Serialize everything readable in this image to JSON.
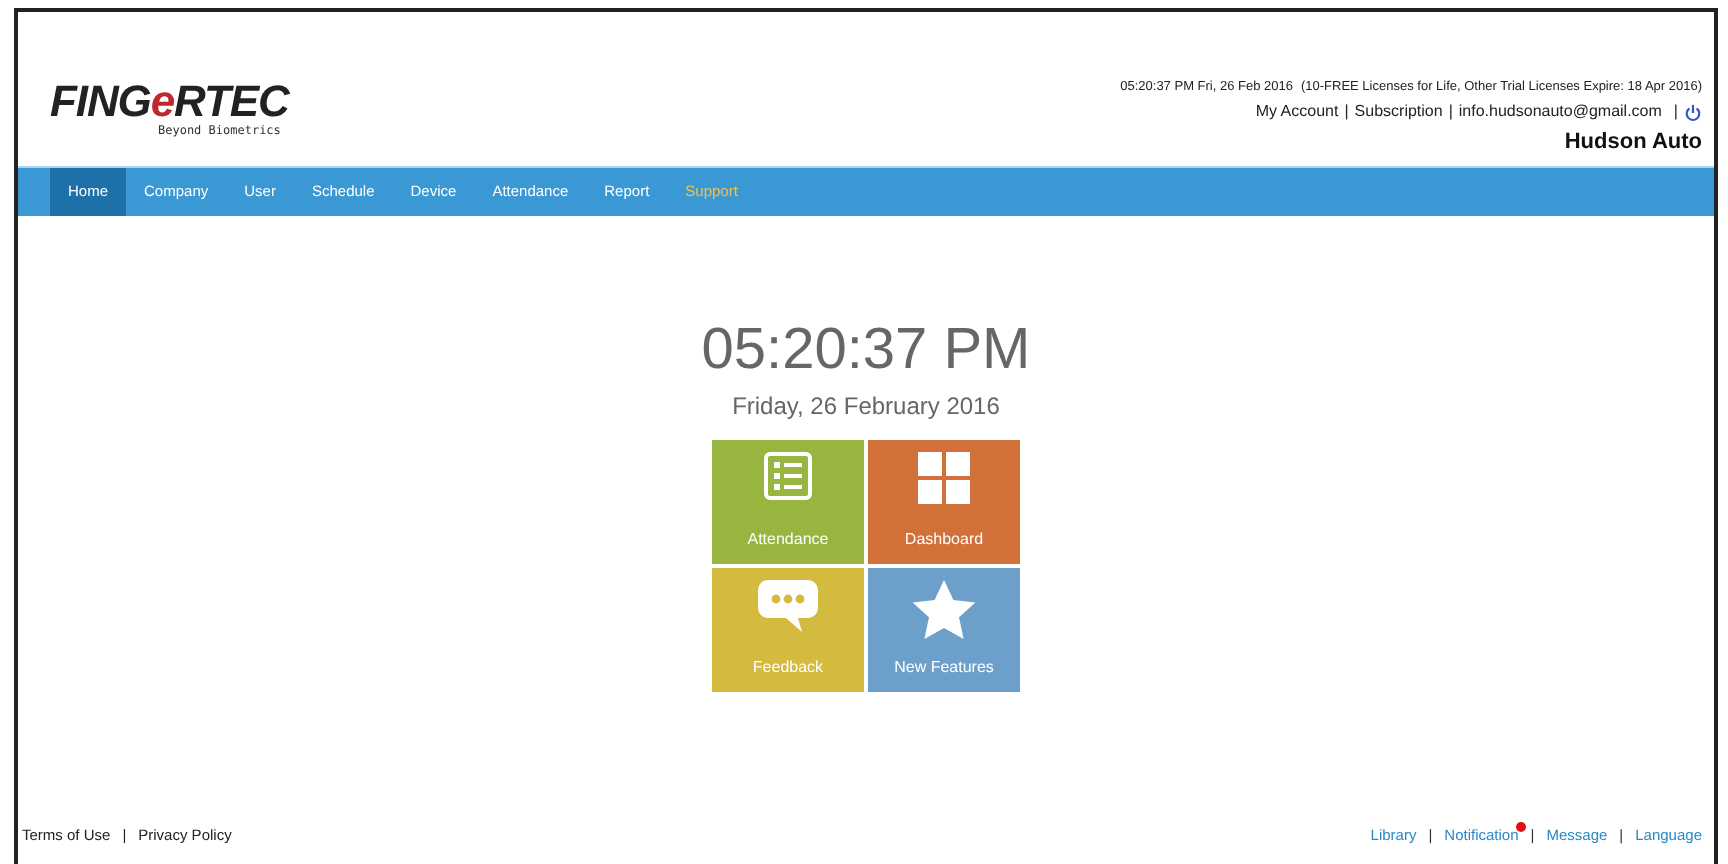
{
  "logo": {
    "before": "FING",
    "mark": "e",
    "after": "RTEC",
    "tagline": "Beyond Biometrics"
  },
  "header": {
    "datetime": "05:20:37 PM Fri, 26 Feb 2016",
    "license": "(10-FREE Licenses for Life, Other Trial Licenses Expire:  18 Apr 2016)",
    "links": [
      {
        "label": "My Account"
      },
      {
        "separator": "|",
        "label": "Subscription"
      },
      {
        "separator": "|",
        "label": "info.hudsonauto@gmail.com"
      }
    ],
    "power_separator": "|",
    "company": "Hudson Auto"
  },
  "nav": [
    {
      "label": "Home",
      "selected": true,
      "highlight": false
    },
    {
      "label": "Company",
      "selected": false,
      "highlight": false
    },
    {
      "label": "User",
      "selected": false,
      "highlight": false
    },
    {
      "label": "Schedule",
      "selected": false,
      "highlight": false
    },
    {
      "label": "Device",
      "selected": false,
      "highlight": false
    },
    {
      "label": "Attendance",
      "selected": false,
      "highlight": false
    },
    {
      "label": "Report",
      "selected": false,
      "highlight": false
    },
    {
      "label": "Support",
      "selected": false,
      "highlight": true
    }
  ],
  "clock": {
    "time": "05:20:37 PM",
    "date": "Friday, 26 February 2016"
  },
  "tiles": [
    {
      "label": "Attendance",
      "kind": "list",
      "color": "#98b540"
    },
    {
      "label": "Dashboard",
      "kind": "grid",
      "color": "#d2703a"
    },
    {
      "label": "Feedback",
      "kind": "chat",
      "color": "#d5ba40"
    },
    {
      "label": "New Features",
      "kind": "star",
      "color": "#6ca0ca"
    }
  ],
  "footer_left": [
    {
      "label": "Terms of Use"
    },
    {
      "separator": "|",
      "label": "Privacy Policy"
    }
  ],
  "footer_right": [
    {
      "label": "Library",
      "badge": false
    },
    {
      "separator": "|",
      "label": "Notification",
      "badge": true
    },
    {
      "separator": "|",
      "label": "Message",
      "badge": false
    },
    {
      "separator": "|",
      "label": "Language",
      "badge": false
    }
  ]
}
